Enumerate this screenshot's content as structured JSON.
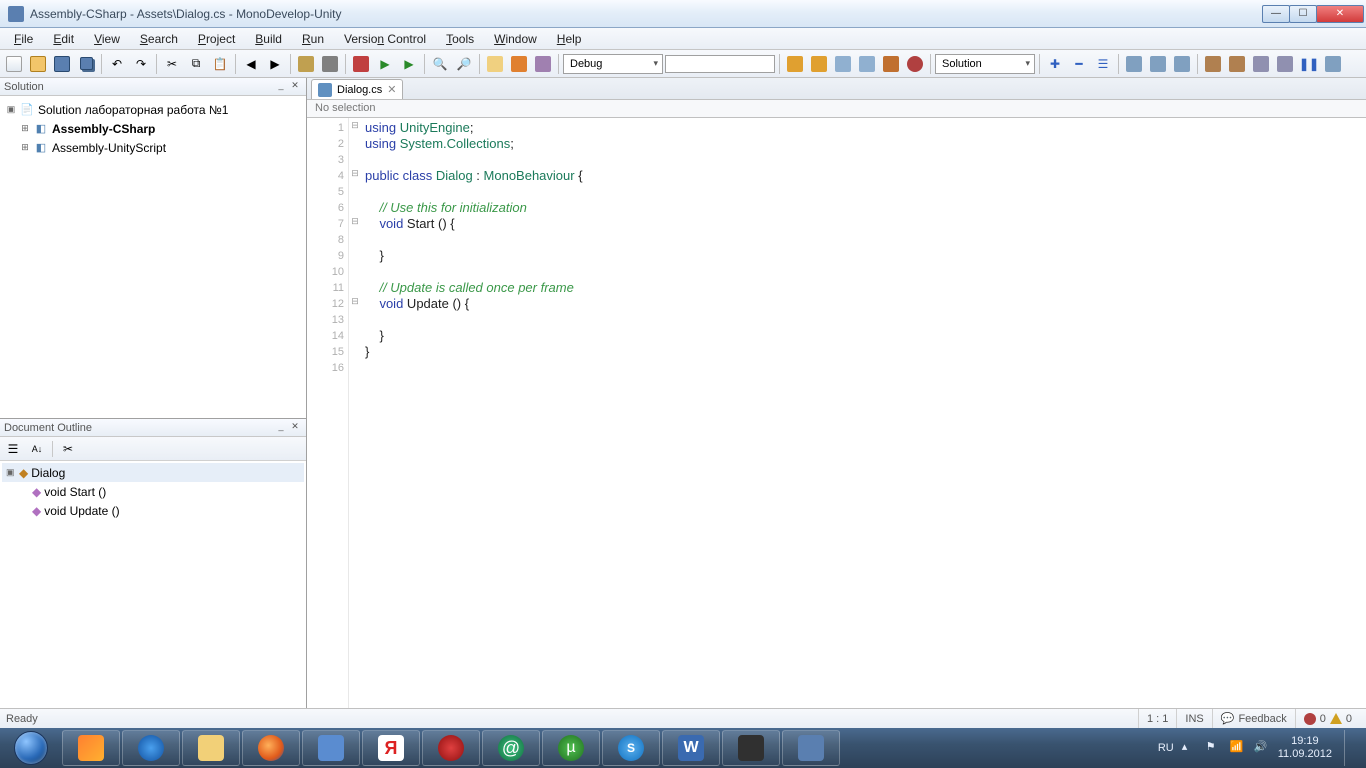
{
  "window": {
    "title": "Assembly-CSharp - Assets\\Dialog.cs - MonoDevelop-Unity"
  },
  "menu": [
    "File",
    "Edit",
    "View",
    "Search",
    "Project",
    "Build",
    "Run",
    "Version Control",
    "Tools",
    "Window",
    "Help"
  ],
  "toolbar": {
    "config_combo": "Debug",
    "target_combo": "Solution"
  },
  "solution_panel": {
    "title": "Solution",
    "root": "Solution лабораторная работа №1",
    "items": [
      {
        "label": "Assembly-CSharp",
        "bold": true
      },
      {
        "label": "Assembly-UnityScript",
        "bold": false
      }
    ]
  },
  "outline_panel": {
    "title": "Document Outline",
    "root": "Dialog",
    "members": [
      "void Start ()",
      "void Update ()"
    ]
  },
  "editor": {
    "tab_label": "Dialog.cs",
    "breadcrumb": "No selection",
    "lines": [
      {
        "n": 1,
        "fold": "-",
        "html": "<span class='kw'>using</span> <span class='type'>UnityEngine</span>;"
      },
      {
        "n": 2,
        "fold": "",
        "html": "<span class='kw'>using</span> <span class='type'>System.Collections</span>;"
      },
      {
        "n": 3,
        "fold": "",
        "html": ""
      },
      {
        "n": 4,
        "fold": "-",
        "html": "<span class='kw'>public class</span> <span class='type'>Dialog</span> : <span class='type'>MonoBehaviour</span> {"
      },
      {
        "n": 5,
        "fold": "",
        "html": ""
      },
      {
        "n": 6,
        "fold": "",
        "html": "    <span class='cm'>// Use this for initialization</span>"
      },
      {
        "n": 7,
        "fold": "-",
        "html": "    <span class='kw'>void</span> Start () {"
      },
      {
        "n": 8,
        "fold": "",
        "html": "    "
      },
      {
        "n": 9,
        "fold": "",
        "html": "    }"
      },
      {
        "n": 10,
        "fold": "",
        "html": "    "
      },
      {
        "n": 11,
        "fold": "",
        "html": "    <span class='cm'>// Update is called once per frame</span>"
      },
      {
        "n": 12,
        "fold": "-",
        "html": "    <span class='kw'>void</span> Update () {"
      },
      {
        "n": 13,
        "fold": "",
        "html": "    "
      },
      {
        "n": 14,
        "fold": "",
        "html": "    }"
      },
      {
        "n": 15,
        "fold": "",
        "html": "}"
      },
      {
        "n": 16,
        "fold": "",
        "html": ""
      }
    ]
  },
  "statusbar": {
    "left": "Ready",
    "pos": "1 : 1",
    "mode": "INS",
    "feedback": "Feedback",
    "errors": "0",
    "warnings": "0"
  },
  "taskbar": {
    "lang": "RU",
    "time": "19:19",
    "date": "11.09.2012"
  }
}
